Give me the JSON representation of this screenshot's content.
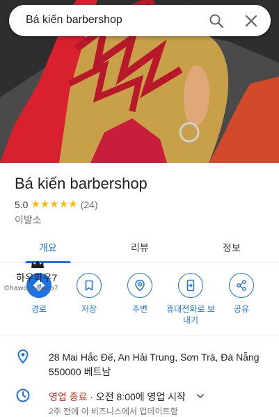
{
  "search": {
    "query": "Bá kiến barbershop"
  },
  "place": {
    "name": "Bá kiến barbershop",
    "rating": "5.0",
    "stars": 5,
    "review_count": "(24)",
    "category": "이발소"
  },
  "tabs": [
    {
      "label": "개요",
      "active": true
    },
    {
      "label": "리뷰",
      "active": false
    },
    {
      "label": "정보",
      "active": false
    }
  ],
  "actions": [
    {
      "label": "경로",
      "icon": "directions-icon"
    },
    {
      "label": "저장",
      "icon": "bookmark-icon"
    },
    {
      "label": "주변",
      "icon": "nearby-icon"
    },
    {
      "label": "휴대전화로 보\n내기",
      "icon": "send-to-phone-icon"
    },
    {
      "label": "공유",
      "icon": "share-icon"
    }
  ],
  "watermark": {
    "korean": "하우하우7",
    "handle": "©hawoohawoo7"
  },
  "info": {
    "address": "28 Mai Hắc Đế, An Hải Trung, Sơn Trà, Đà Nẵng 550000 베트남",
    "hours_status": "영업 종료",
    "hours_detail": " · 오전 8:00에 영업 시작",
    "updated": "2주 전에 이 비즈니스에서 업데이트함"
  },
  "colors": {
    "accent": "#1a73e8",
    "star": "#fbbc04",
    "closed": "#d93025"
  }
}
